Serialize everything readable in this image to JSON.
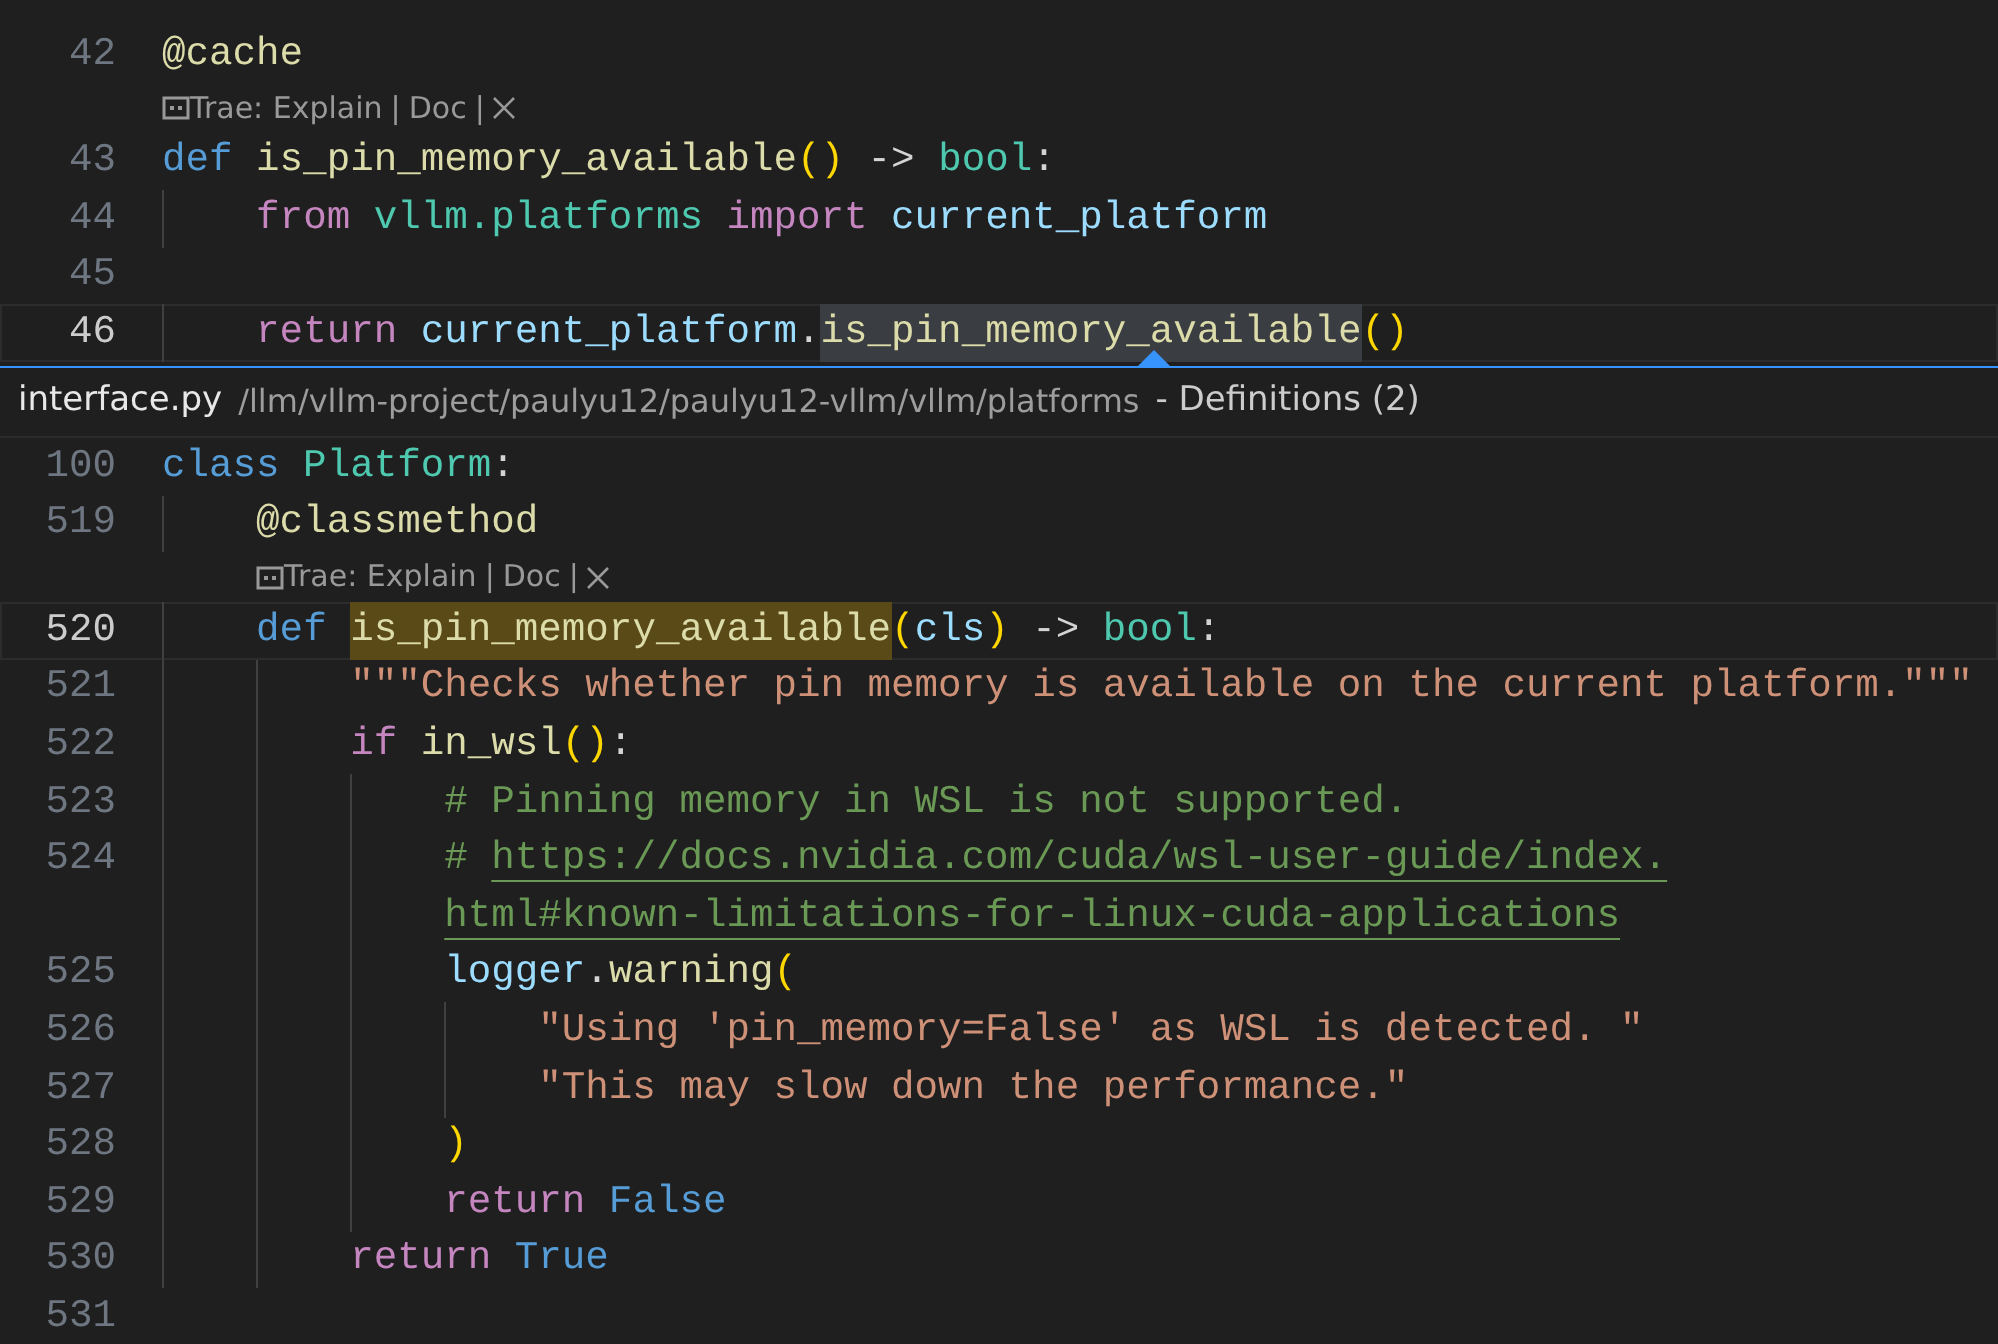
{
  "editor": {
    "lines": [
      {
        "num": "42",
        "current": false,
        "tokens": [
          {
            "text": "@cache",
            "kind": "func"
          }
        ]
      },
      {
        "kind": "codelens",
        "indented": false,
        "parts": [
          {
            "kind": "link",
            "text": "Trae: Explain"
          },
          {
            "kind": "sep",
            "text": "|"
          },
          {
            "kind": "link",
            "text": "Doc"
          },
          {
            "kind": "sep",
            "text": "|"
          }
        ]
      },
      {
        "num": "43",
        "current": false,
        "tokens": [
          {
            "text": "def",
            "kind": "keyword"
          },
          {
            "text": " is_pin_memory_available",
            "kind": "func"
          },
          {
            "text": "()",
            "kind": "bracket"
          },
          {
            "text": " -> ",
            "kind": "plain"
          },
          {
            "text": "bool",
            "kind": "type"
          },
          {
            "text": ":",
            "kind": "plain"
          }
        ]
      },
      {
        "num": "44",
        "current": false,
        "tokens": [
          {
            "text": "    from",
            "kind": "control"
          },
          {
            "text": " vllm.platforms",
            "kind": "type"
          },
          {
            "text": " import",
            "kind": "control"
          },
          {
            "text": " current_platform",
            "kind": "var"
          }
        ]
      },
      {
        "num": "45",
        "current": false
      },
      {
        "num": "46",
        "current": true,
        "tokens": [
          {
            "text": "    return",
            "kind": "control"
          },
          {
            "text": " current_platform",
            "kind": "var"
          },
          {
            "text": ".",
            "kind": "plain"
          },
          {
            "text": "is_pin_memory_available",
            "kind": "func",
            "highlighted": true
          },
          {
            "text": "()",
            "kind": "bracket"
          }
        ]
      }
    ]
  },
  "peek": {
    "file": "interface.py",
    "path": "/llm/vllm-project/paulyu12/paulyu12-vllm/vllm/platforms",
    "title": "- Definitions (2)",
    "lines": [
      {
        "num": "100",
        "current": false,
        "tokens": [
          {
            "text": "class",
            "kind": "keyword"
          },
          {
            "text": " Platform",
            "kind": "type"
          },
          {
            "text": ":",
            "kind": "plain"
          }
        ]
      },
      {
        "num": "519",
        "current": false,
        "tokens": [
          {
            "text": "    @classmethod",
            "kind": "func"
          }
        ]
      },
      {
        "kind": "codelens",
        "indented": true,
        "parts": [
          {
            "kind": "link",
            "text": "Trae: Explain"
          },
          {
            "kind": "sep",
            "text": "|"
          },
          {
            "kind": "link",
            "text": "Doc"
          },
          {
            "kind": "sep",
            "text": "|"
          }
        ]
      },
      {
        "num": "520",
        "current": true,
        "tokens": [
          {
            "text": "    def ",
            "kind": "keyword"
          },
          {
            "text": "is_pin_memory_available",
            "kind": "func",
            "highlighted": true
          },
          {
            "text": "(",
            "kind": "bracket"
          },
          {
            "text": "cls",
            "kind": "var"
          },
          {
            "text": ")",
            "kind": "bracket"
          },
          {
            "text": " ->",
            "kind": "plain"
          },
          {
            "text": " bool",
            "kind": "type"
          },
          {
            "text": ":",
            "kind": "plain"
          }
        ]
      },
      {
        "num": "521",
        "current": false,
        "tokens": [
          {
            "text": "        \"\"\"Checks whether pin memory is available on the current platform.\"\"\"",
            "kind": "string"
          }
        ]
      },
      {
        "num": "522",
        "current": false,
        "tokens": [
          {
            "text": "        if",
            "kind": "control"
          },
          {
            "text": " in_wsl",
            "kind": "func"
          },
          {
            "text": "()",
            "kind": "bracket"
          },
          {
            "text": ":",
            "kind": "plain"
          }
        ]
      },
      {
        "num": "523",
        "current": false,
        "tokens": [
          {
            "text": "            # Pinning memory in WSL is not supported.",
            "kind": "comment"
          }
        ]
      },
      {
        "num": "524",
        "current": false,
        "tokens": [
          {
            "text": "            # ",
            "kind": "comment"
          },
          {
            "text": "https://docs.nvidia.com/cuda/wsl-user-guide/index.",
            "kind": "url"
          }
        ]
      },
      {
        "current": false,
        "tokens": [
          {
            "text": "            html#known-limitations-for-linux-cuda-applications",
            "kind": "url"
          }
        ]
      },
      {
        "num": "525",
        "current": false,
        "tokens": [
          {
            "text": "            logger",
            "kind": "var"
          },
          {
            "text": ".",
            "kind": "plain"
          },
          {
            "text": "warning",
            "kind": "func"
          },
          {
            "text": "(",
            "kind": "bracket"
          }
        ]
      },
      {
        "num": "526",
        "current": false,
        "tokens": [
          {
            "text": "                \"Using 'pin_memory=False' as WSL is detected. \"",
            "kind": "string"
          }
        ]
      },
      {
        "num": "527",
        "current": false,
        "tokens": [
          {
            "text": "                \"This may slow down the performance.\"",
            "kind": "string"
          }
        ]
      },
      {
        "num": "528",
        "current": false,
        "tokens": [
          {
            "text": "            )",
            "kind": "bracket"
          }
        ]
      },
      {
        "num": "529",
        "current": false,
        "tokens": [
          {
            "text": "            return",
            "kind": "control"
          },
          {
            "text": " False",
            "kind": "keyword"
          }
        ]
      },
      {
        "num": "530",
        "current": false,
        "tokens": [
          {
            "text": "        return",
            "kind": "control"
          },
          {
            "text": " True",
            "kind": "keyword"
          }
        ]
      },
      {
        "num": "531",
        "current": false
      }
    ]
  }
}
